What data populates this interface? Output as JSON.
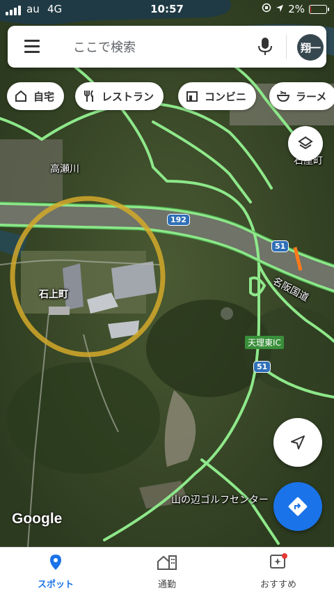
{
  "status": {
    "carrier": "au",
    "network": "4G",
    "time": "10:57",
    "battery": "2%",
    "battery_fill": 0.02
  },
  "search": {
    "placeholder": "ここで検索",
    "avatar": "翔一"
  },
  "chips": [
    {
      "label": "自宅",
      "icon": "home-icon"
    },
    {
      "label": "レストラン",
      "icon": "restaurant-icon"
    },
    {
      "label": "コンビニ",
      "icon": "store-icon"
    },
    {
      "label": "ラーメ",
      "icon": "ramen-icon"
    }
  ],
  "map": {
    "labels": {
      "river": "高瀬川",
      "town": "石上町",
      "town_ne": "石屋町",
      "expressway": "名阪国道",
      "golf": "山の辺ゴルフセンター",
      "ic": "天理東IC"
    },
    "shields": {
      "route192": "192",
      "route51a": "51",
      "route51b": "51"
    },
    "logo": "Google",
    "colors": {
      "road": "#8ee88a",
      "road_edge": "#4caf50",
      "circle": "#d4a92a",
      "accent": "#1a73e8"
    }
  },
  "nav": {
    "tabs": [
      {
        "label": "スポット",
        "icon": "location-pin-icon",
        "active": true
      },
      {
        "label": "通勤",
        "icon": "commute-building-icon",
        "active": false
      },
      {
        "label": "おすすめ",
        "icon": "sparkle-recommend-icon",
        "active": false
      }
    ]
  }
}
